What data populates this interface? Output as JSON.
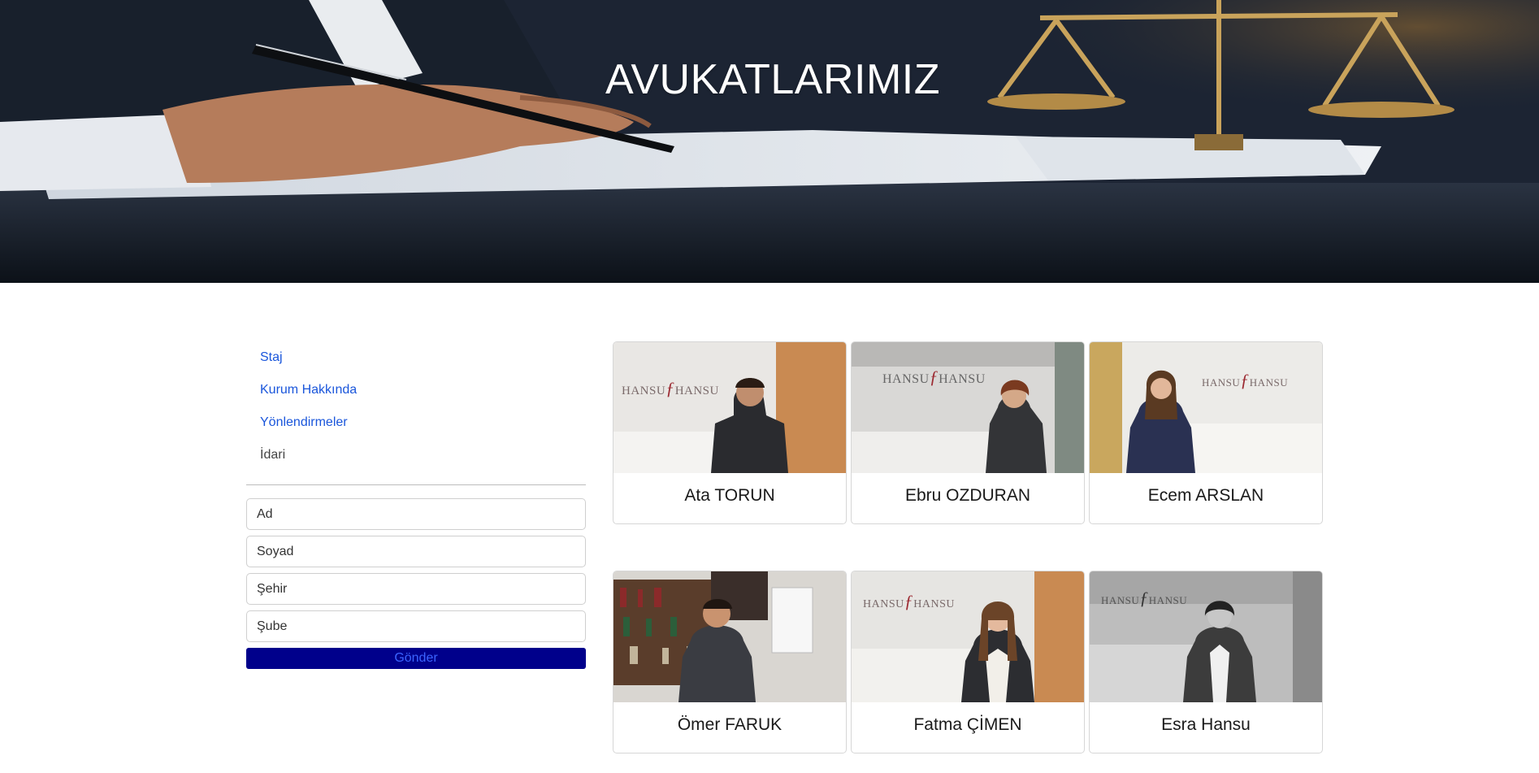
{
  "hero": {
    "title": "AVUKATLARIMIZ"
  },
  "sidebar": {
    "nav": [
      {
        "label": "Staj",
        "link": true
      },
      {
        "label": "Kurum Hakkında",
        "link": true
      },
      {
        "label": "Yönlendirmeler",
        "link": true
      },
      {
        "label": "İdari",
        "link": false
      }
    ],
    "form": {
      "first_name_placeholder": "Ad",
      "last_name_placeholder": "Soyad",
      "city_placeholder": "Şehir",
      "branch_placeholder": "Şube",
      "submit_label": "Gönder"
    }
  },
  "lawyers": [
    {
      "name": "Ata TORUN"
    },
    {
      "name": "Ebru OZDURAN"
    },
    {
      "name": "Ecem ARSLAN"
    },
    {
      "name": "Ömer FARUK"
    },
    {
      "name": "Fatma ÇİMEN"
    },
    {
      "name": "Esra Hansu"
    }
  ],
  "colors": {
    "link": "#1a56db",
    "submit_bg": "#00008b",
    "submit_text": "#3b64ff"
  }
}
